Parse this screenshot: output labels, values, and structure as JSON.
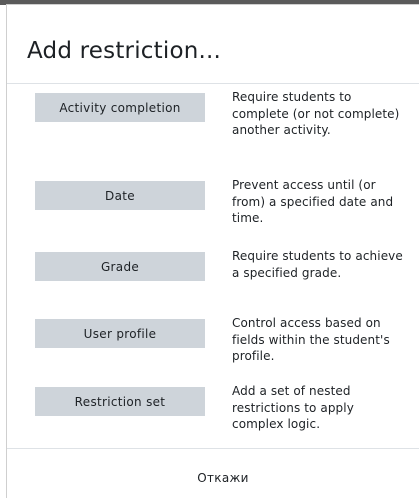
{
  "dialog": {
    "title": "Add restriction..."
  },
  "options": [
    {
      "button_label": "Activity completion",
      "description": "Require students to complete (or not complete) another activity."
    },
    {
      "button_label": "Date",
      "description": "Prevent access until (or from) a specified date and time."
    },
    {
      "button_label": "Grade",
      "description": "Require students to achieve a specified grade."
    },
    {
      "button_label": "User profile",
      "description": "Control access based on fields within the student's profile."
    },
    {
      "button_label": "Restriction set",
      "description": "Add a set of nested restrictions to apply complex logic."
    }
  ],
  "footer": {
    "cancel_label": "Откажи"
  },
  "colors": {
    "button_background": "#ced4da",
    "text": "#1d2125",
    "divider": "#dee2e6"
  }
}
